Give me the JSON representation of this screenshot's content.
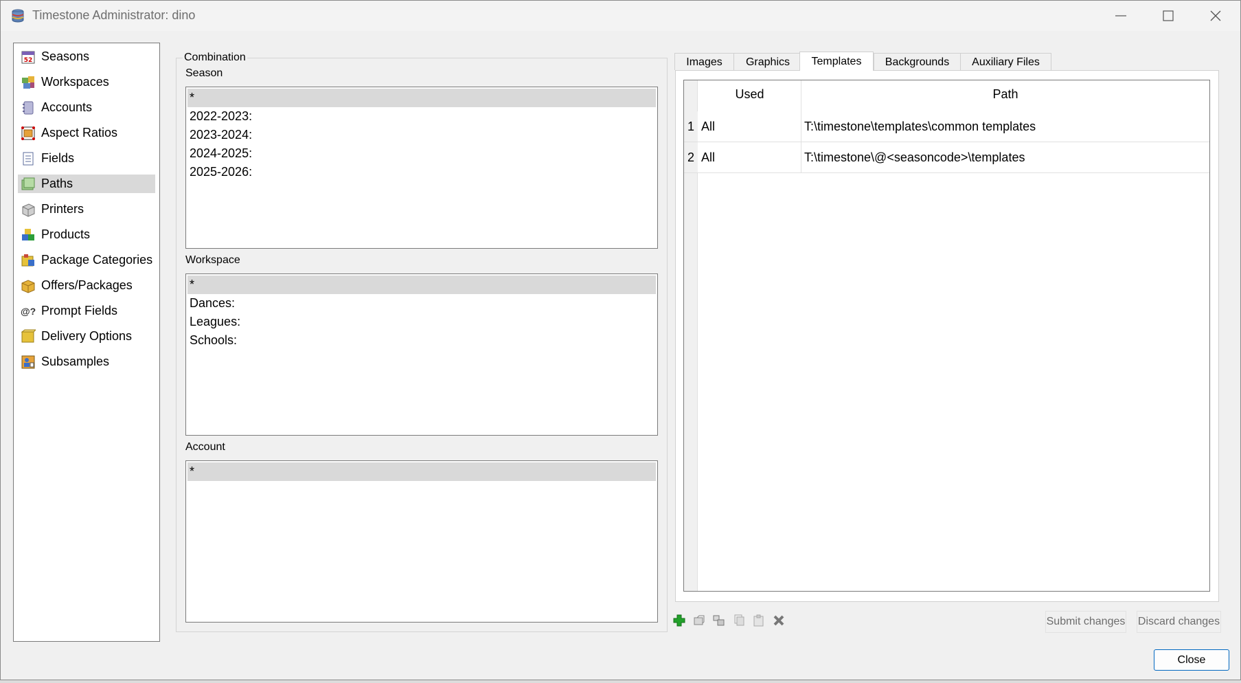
{
  "window": {
    "title": "Timestone Administrator: dino"
  },
  "sidebar": {
    "items": [
      {
        "label": "Seasons",
        "icon": "calendar-icon"
      },
      {
        "label": "Workspaces",
        "icon": "workspaces-icon"
      },
      {
        "label": "Accounts",
        "icon": "accounts-icon"
      },
      {
        "label": "Aspect Ratios",
        "icon": "aspect-ratio-icon"
      },
      {
        "label": "Fields",
        "icon": "fields-icon"
      },
      {
        "label": "Paths",
        "icon": "paths-icon",
        "selected": true
      },
      {
        "label": "Printers",
        "icon": "printer-icon"
      },
      {
        "label": "Products",
        "icon": "products-icon"
      },
      {
        "label": "Package Categories",
        "icon": "package-categories-icon"
      },
      {
        "label": "Offers/Packages",
        "icon": "offers-icon"
      },
      {
        "label": "Prompt Fields",
        "icon": "prompt-fields-icon",
        "glyph": "@?"
      },
      {
        "label": "Delivery Options",
        "icon": "delivery-icon"
      },
      {
        "label": "Subsamples",
        "icon": "subsamples-icon"
      }
    ]
  },
  "combination": {
    "title": "Combination",
    "season": {
      "label": "Season",
      "items": [
        "*",
        "2022-2023:",
        "2023-2024:",
        "2024-2025:",
        "2025-2026:"
      ]
    },
    "workspace": {
      "label": "Workspace",
      "items": [
        "*",
        "Dances:",
        "Leagues:",
        "Schools:"
      ]
    },
    "account": {
      "label": "Account",
      "items": [
        "*"
      ]
    }
  },
  "tabs": [
    {
      "label": "Images"
    },
    {
      "label": "Graphics"
    },
    {
      "label": "Templates",
      "active": true
    },
    {
      "label": "Backgrounds"
    },
    {
      "label": "Auxiliary Files"
    }
  ],
  "grid": {
    "columns": [
      "Used",
      "Path"
    ],
    "rows": [
      {
        "num": "1",
        "used": "All",
        "path": "T:\\timestone\\templates\\common templates"
      },
      {
        "num": "2",
        "used": "All",
        "path": "T:\\timestone\\@<seasoncode>\\templates"
      }
    ]
  },
  "toolbar": {
    "icons": [
      "add-icon",
      "edit-icon",
      "duplicate-icon",
      "copy-icon",
      "paste-icon",
      "delete-icon"
    ]
  },
  "buttons": {
    "submit": "Submit changes",
    "discard": "Discard changes",
    "close": "Close"
  },
  "colors": {
    "accent": "#0067c0",
    "selection": "#d9d9d9",
    "add_green": "#22a12a",
    "delete_gray": "#777777"
  }
}
